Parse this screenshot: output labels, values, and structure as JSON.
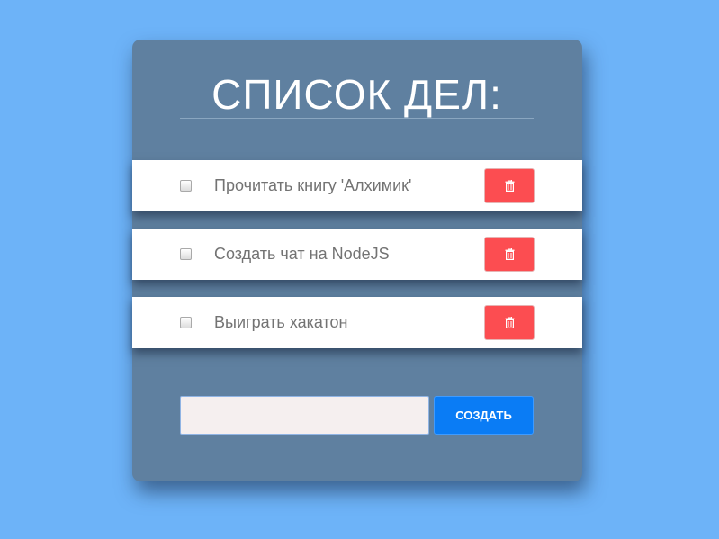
{
  "header": {
    "title": "СПИСОК ДЕЛ:"
  },
  "tasks": [
    {
      "label": "Прочитать книгу 'Алхимик'",
      "checked": false,
      "delete_icon": "trash-icon"
    },
    {
      "label": "Создать чат на NodeJS",
      "checked": false,
      "delete_icon": "trash-icon"
    },
    {
      "label": "Выиграть хакатон",
      "checked": false,
      "delete_icon": "trash-icon"
    }
  ],
  "new_task": {
    "value": "",
    "placeholder": "",
    "create_label": "СОЗДАТЬ"
  },
  "colors": {
    "page_background": "#6db3f8",
    "card_background": "#5f80a0",
    "delete_button": "#fc4d51",
    "create_button": "#0a7cf5",
    "task_text": "#737373"
  }
}
